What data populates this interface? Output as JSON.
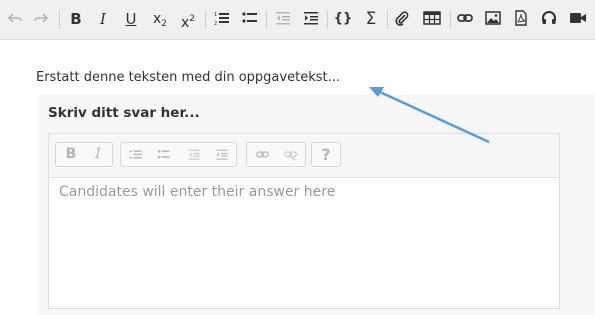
{
  "toolbar": {
    "undo_icon": "undo-icon",
    "redo_icon": "redo-icon",
    "bold_label": "B",
    "italic_label": "I",
    "underline_label": "U",
    "subscript_label": "x",
    "subscript_mark": "2",
    "superscript_label": "x",
    "superscript_mark": "2",
    "code_label": "{}",
    "sum_label": "Σ",
    "icons": [
      "numbered-list-icon",
      "bullet-list-icon",
      "outdent-icon",
      "indent-icon",
      "paperclip-icon",
      "table-icon",
      "link-icon",
      "image-icon",
      "pdf-icon",
      "headphones-icon",
      "video-icon"
    ]
  },
  "content": {
    "prompt_text": "Erstatt denne teksten med din oppgavetekst...",
    "answer_title": "Skriv ditt svar her...",
    "editor_bold": "B",
    "editor_italic": "I",
    "editor_help": "?",
    "placeholder": "Candidates will enter their answer here"
  },
  "colors": {
    "arrow": "#5b9bd5",
    "toolbar_bg": "#f0f0f0",
    "panel_bg": "#f7f7f7"
  }
}
